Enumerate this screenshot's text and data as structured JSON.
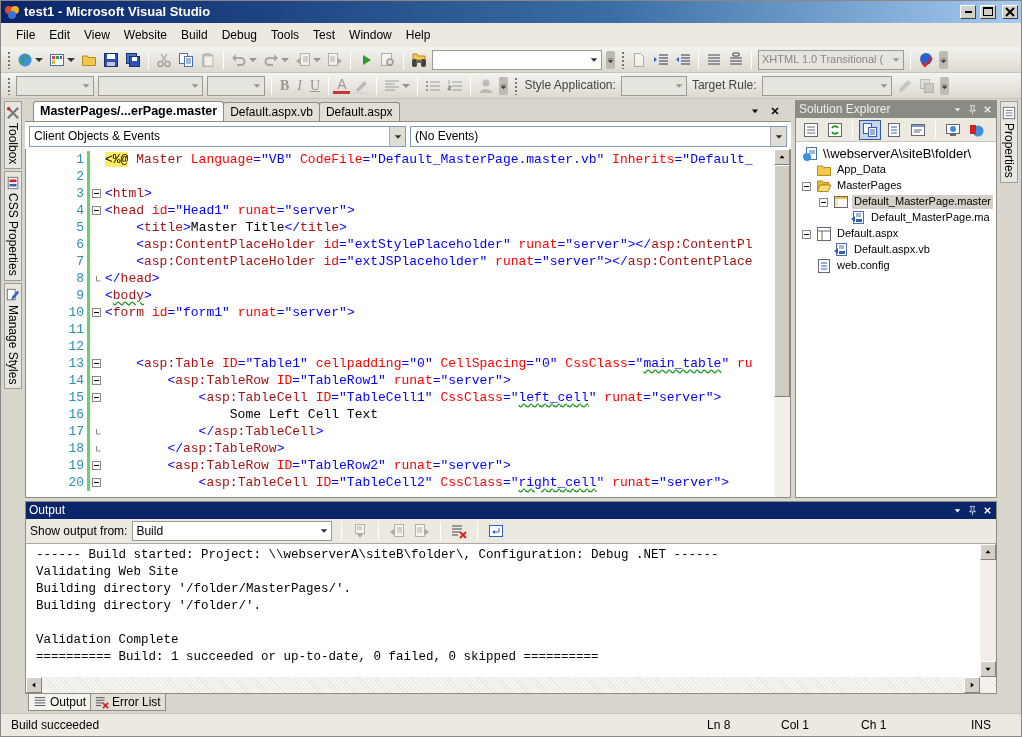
{
  "window": {
    "title": "test1 - Microsoft Visual Studio"
  },
  "menu": [
    "File",
    "Edit",
    "View",
    "Website",
    "Build",
    "Debug",
    "Tools",
    "Test",
    "Window",
    "Help"
  ],
  "toolbars": [
    {
      "items": [
        {
          "kind": "grip"
        },
        {
          "kind": "icon",
          "disabled": false,
          "dropdown": true
        },
        {
          "kind": "icon",
          "disabled": false,
          "dropdown": true
        },
        {
          "kind": "icon",
          "disabled": false
        },
        {
          "kind": "icon",
          "disabled": false
        },
        {
          "kind": "icon",
          "disabled": false
        },
        {
          "kind": "sep"
        },
        {
          "kind": "icon",
          "disabled": true
        },
        {
          "kind": "icon",
          "disabled": false
        },
        {
          "kind": "icon",
          "disabled": true
        },
        {
          "kind": "sep"
        },
        {
          "kind": "icon",
          "disabled": true,
          "dropdown": true
        },
        {
          "kind": "icon",
          "disabled": true,
          "dropdown": true
        },
        {
          "kind": "icon",
          "disabled": true,
          "dropdown": true
        },
        {
          "kind": "icon",
          "disabled": true
        },
        {
          "kind": "sep"
        },
        {
          "kind": "icon",
          "disabled": false
        },
        {
          "kind": "icon",
          "disabled": true
        },
        {
          "kind": "sep"
        },
        {
          "kind": "icon",
          "disabled": false
        },
        {
          "kind": "combo",
          "disabled": false
        },
        {
          "kind": "overflow"
        },
        {
          "kind": "grip"
        },
        {
          "kind": "icon",
          "disabled": true
        },
        {
          "kind": "icon",
          "disabled": false
        },
        {
          "kind": "icon",
          "disabled": false
        },
        {
          "kind": "sep"
        },
        {
          "kind": "icon",
          "disabled": false
        },
        {
          "kind": "icon",
          "disabled": false
        },
        {
          "kind": "sep"
        },
        {
          "kind": "combo",
          "disabled": true,
          "value": "XHTML 1.0 Transitional ("
        },
        {
          "kind": "sep"
        },
        {
          "kind": "icon",
          "disabled": false
        },
        {
          "kind": "overflow"
        }
      ]
    },
    {
      "items": [
        {
          "kind": "grip"
        },
        {
          "kind": "combo",
          "disabled": true
        },
        {
          "kind": "combo",
          "disabled": true
        },
        {
          "kind": "combo",
          "disabled": true
        },
        {
          "kind": "sep"
        },
        {
          "kind": "glyph",
          "text": "B",
          "disabled": true
        },
        {
          "kind": "glyph",
          "text": "I",
          "disabled": true
        },
        {
          "kind": "glyph",
          "text": "U",
          "disabled": true
        },
        {
          "kind": "sep"
        },
        {
          "kind": "glyph",
          "text": "A",
          "disabled": true
        },
        {
          "kind": "icon",
          "disabled": true
        },
        {
          "kind": "sep"
        },
        {
          "kind": "icon",
          "disabled": true,
          "dropdown": true
        },
        {
          "kind": "sep"
        },
        {
          "kind": "icon",
          "disabled": true
        },
        {
          "kind": "icon",
          "disabled": true
        },
        {
          "kind": "sep"
        },
        {
          "kind": "icon",
          "disabled": true
        },
        {
          "kind": "overflow"
        },
        {
          "kind": "grip"
        },
        {
          "kind": "label",
          "text": "Style Application:"
        },
        {
          "kind": "combo",
          "disabled": true
        },
        {
          "kind": "label",
          "text": "Target Rule:"
        },
        {
          "kind": "combo",
          "disabled": true
        },
        {
          "kind": "icon",
          "disabled": true
        },
        {
          "kind": "icon",
          "disabled": true
        },
        {
          "kind": "overflow"
        }
      ]
    }
  ],
  "left_tabs": [
    "Toolbox",
    "CSS Properties",
    "Manage Styles"
  ],
  "right_tabs": [
    "Properties"
  ],
  "editor": {
    "tabs": [
      {
        "label": "MasterPages/...erPage.master",
        "selected": true
      },
      {
        "label": "Default.aspx.vb",
        "selected": false
      },
      {
        "label": "Default.aspx",
        "selected": false
      }
    ],
    "object_combo": "Client Objects & Events",
    "event_combo": "(No Events)",
    "lines": [
      {
        "number": "1",
        "tokens": [
          {
            "kind": "dir",
            "text": "<%@"
          },
          {
            "kind": "tag",
            "text": " Master"
          },
          {
            "kind": "attr",
            "text": " Language"
          },
          {
            "kind": "val",
            "text": "=\"VB\""
          },
          {
            "kind": "attr",
            "text": " CodeFile"
          },
          {
            "kind": "val",
            "text": "=\"Default_MasterPage.master.vb\""
          },
          {
            "kind": "attr",
            "text": " Inherits"
          },
          {
            "kind": "val",
            "text": "=\"Default_"
          }
        ]
      },
      {
        "number": "2"
      },
      {
        "number": "3",
        "collapsible": true,
        "tokens": [
          {
            "kind": "delim",
            "text": "<"
          },
          {
            "kind": "tag",
            "text": "html"
          },
          {
            "kind": "delim",
            "text": ">"
          }
        ]
      },
      {
        "number": "4",
        "collapsible": true,
        "tokens": [
          {
            "kind": "delim",
            "text": "<"
          },
          {
            "kind": "tag",
            "text": "head"
          },
          {
            "kind": "attr",
            "text": " id"
          },
          {
            "kind": "val",
            "text": "=\"Head1\""
          },
          {
            "kind": "attr",
            "text": " runat"
          },
          {
            "kind": "val",
            "text": "=\"server\""
          },
          {
            "kind": "delim",
            "text": ">"
          }
        ]
      },
      {
        "number": "5",
        "tokens": [
          {
            "kind": "delim",
            "text": "    <"
          },
          {
            "kind": "tag",
            "text": "title"
          },
          {
            "kind": "delim",
            "text": ">"
          },
          {
            "kind": "text",
            "text": "Master Title"
          },
          {
            "kind": "delim",
            "text": "</"
          },
          {
            "kind": "tag",
            "text": "title"
          },
          {
            "kind": "delim",
            "text": ">"
          }
        ]
      },
      {
        "number": "6",
        "tokens": [
          {
            "kind": "delim",
            "text": "    <"
          },
          {
            "kind": "tag",
            "text": "asp:ContentPlaceHolder"
          },
          {
            "kind": "attr",
            "text": " id"
          },
          {
            "kind": "val",
            "text": "=\"extStylePlaceholder\""
          },
          {
            "kind": "attr",
            "text": " runat"
          },
          {
            "kind": "val",
            "text": "=\"server\""
          },
          {
            "kind": "delim",
            "text": "></"
          },
          {
            "kind": "tag",
            "text": "asp:ContentPl"
          }
        ]
      },
      {
        "number": "7",
        "tokens": [
          {
            "kind": "delim",
            "text": "    <"
          },
          {
            "kind": "tag",
            "text": "asp:ContentPlaceHolder"
          },
          {
            "kind": "attr",
            "text": " id"
          },
          {
            "kind": "val",
            "text": "=\"extJSPlaceholder\""
          },
          {
            "kind": "attr",
            "text": " runat"
          },
          {
            "kind": "val",
            "text": "=\"server\""
          },
          {
            "kind": "delim",
            "text": "></"
          },
          {
            "kind": "tag",
            "text": "asp:ContentPlace"
          }
        ]
      },
      {
        "number": "8",
        "block_end": true,
        "tokens": [
          {
            "kind": "delim",
            "text": "</"
          },
          {
            "kind": "tag",
            "text": "head"
          },
          {
            "kind": "delim",
            "text": ">"
          }
        ]
      },
      {
        "number": "9",
        "tokens": [
          {
            "kind": "delim",
            "text": "<"
          },
          {
            "kind": "tag",
            "text": "body",
            "squiggle": true
          },
          {
            "kind": "delim",
            "text": ">"
          }
        ]
      },
      {
        "number": "10",
        "collapsible": true,
        "tokens": [
          {
            "kind": "delim",
            "text": "<"
          },
          {
            "kind": "tag",
            "text": "form"
          },
          {
            "kind": "attr",
            "text": " id"
          },
          {
            "kind": "val",
            "text": "=\"form1\""
          },
          {
            "kind": "attr",
            "text": " runat"
          },
          {
            "kind": "val",
            "text": "=\"server\""
          },
          {
            "kind": "delim",
            "text": ">"
          }
        ]
      },
      {
        "number": "11"
      },
      {
        "number": "12"
      },
      {
        "number": "13",
        "collapsible": true,
        "tokens": [
          {
            "kind": "delim",
            "text": "    <"
          },
          {
            "kind": "tag",
            "text": "asp:Table"
          },
          {
            "kind": "attr",
            "text": " ID"
          },
          {
            "kind": "val",
            "text": "=\"Table1\""
          },
          {
            "kind": "attr",
            "text": " cellpadding"
          },
          {
            "kind": "val",
            "text": "=\"0\""
          },
          {
            "kind": "attr",
            "text": " CellSpacing"
          },
          {
            "kind": "val",
            "text": "=\"0\""
          },
          {
            "kind": "attr",
            "text": " CssClass"
          },
          {
            "kind": "val",
            "text": "=\""
          },
          {
            "kind": "val",
            "text": "main_table",
            "squiggle": true
          },
          {
            "kind": "val",
            "text": "\""
          },
          {
            "kind": "attr",
            "text": " ru"
          }
        ]
      },
      {
        "number": "14",
        "collapsible": true,
        "tokens": [
          {
            "kind": "delim",
            "text": "        <"
          },
          {
            "kind": "tag",
            "text": "asp:TableRow"
          },
          {
            "kind": "attr",
            "text": " ID"
          },
          {
            "kind": "val",
            "text": "=\"TableRow1\""
          },
          {
            "kind": "attr",
            "text": " runat"
          },
          {
            "kind": "val",
            "text": "=\"server\""
          },
          {
            "kind": "delim",
            "text": ">"
          }
        ]
      },
      {
        "number": "15",
        "collapsible": true,
        "tokens": [
          {
            "kind": "delim",
            "text": "            <"
          },
          {
            "kind": "tag",
            "text": "asp:TableCell"
          },
          {
            "kind": "attr",
            "text": " ID"
          },
          {
            "kind": "val",
            "text": "=\"TableCell1\""
          },
          {
            "kind": "attr",
            "text": " CssClass"
          },
          {
            "kind": "val",
            "text": "=\""
          },
          {
            "kind": "val",
            "text": "left_cell",
            "squiggle": true
          },
          {
            "kind": "val",
            "text": "\""
          },
          {
            "kind": "attr",
            "text": " runat"
          },
          {
            "kind": "val",
            "text": "=\"server\""
          },
          {
            "kind": "delim",
            "text": ">"
          }
        ]
      },
      {
        "number": "16",
        "tokens": [
          {
            "kind": "text",
            "text": "                Some Left Cell Text"
          }
        ]
      },
      {
        "number": "17",
        "block_end": true,
        "tokens": [
          {
            "kind": "delim",
            "text": "            </"
          },
          {
            "kind": "tag",
            "text": "asp:TableCell"
          },
          {
            "kind": "delim",
            "text": ">"
          }
        ]
      },
      {
        "number": "18",
        "block_end": true,
        "tokens": [
          {
            "kind": "delim",
            "text": "        </"
          },
          {
            "kind": "tag",
            "text": "asp:TableRow"
          },
          {
            "kind": "delim",
            "text": ">"
          }
        ]
      },
      {
        "number": "19",
        "collapsible": true,
        "tokens": [
          {
            "kind": "delim",
            "text": "        <"
          },
          {
            "kind": "tag",
            "text": "asp:TableRow"
          },
          {
            "kind": "attr",
            "text": " ID"
          },
          {
            "kind": "val",
            "text": "=\"TableRow2\""
          },
          {
            "kind": "attr",
            "text": " runat"
          },
          {
            "kind": "val",
            "text": "=\"server\""
          },
          {
            "kind": "delim",
            "text": ">"
          }
        ]
      },
      {
        "number": "20",
        "collapsible": true,
        "tokens": [
          {
            "kind": "delim",
            "text": "            <"
          },
          {
            "kind": "tag",
            "text": "asp:TableCell"
          },
          {
            "kind": "attr",
            "text": " ID"
          },
          {
            "kind": "val",
            "text": "=\"TableCell2\""
          },
          {
            "kind": "attr",
            "text": " CssClass"
          },
          {
            "kind": "val",
            "text": "=\""
          },
          {
            "kind": "val",
            "text": "right_cell",
            "squiggle": true
          },
          {
            "kind": "val",
            "text": "\""
          },
          {
            "kind": "attr",
            "text": " runat"
          },
          {
            "kind": "val",
            "text": "=\"server\""
          },
          {
            "kind": "delim",
            "text": ">"
          }
        ]
      }
    ]
  },
  "solution_explorer": {
    "title": "Solution Explorer",
    "tools": [
      {
        "pressed": false
      },
      {
        "pressed": false
      },
      {
        "pressed": true
      },
      {
        "pressed": false
      },
      {
        "pressed": false
      },
      {
        "pressed": false
      },
      {
        "pressed": false
      }
    ],
    "tree": {
      "label": "\\\\webserverA\\siteB\\folder\\",
      "kind": "project",
      "selected": false,
      "children": [
        {
          "label": "App_Data",
          "kind": "folder",
          "selected": false
        },
        {
          "label": "MasterPages",
          "kind": "folder-open",
          "selected": false,
          "expanded": true,
          "children": [
            {
              "label": "Default_MasterPage.master",
              "kind": "master",
              "selected": true,
              "expanded": true,
              "children": [
                {
                  "label": "Default_MasterPage.ma",
                  "kind": "code",
                  "selected": false
                }
              ]
            }
          ]
        },
        {
          "label": "Default.aspx",
          "kind": "page",
          "selected": false,
          "expanded": true,
          "children": [
            {
              "label": "Default.aspx.vb",
              "kind": "code",
              "selected": false
            }
          ]
        },
        {
          "label": "web.config",
          "kind": "config",
          "selected": false
        }
      ]
    }
  },
  "output": {
    "title": "Output",
    "show_from_label": "Show output from:",
    "source": "Build",
    "tools": [
      {
        "disabled": true
      },
      {
        "disabled": true
      },
      {
        "disabled": true
      },
      {
        "disabled": false
      },
      {
        "disabled": false
      }
    ],
    "blocks": [
      [
        "------ Build started: Project: \\\\webserverA\\siteB\\folder\\, Configuration: Debug .NET ------",
        "Validating Web Site",
        "Building directory '/folder/MasterPages/'.",
        "Building directory '/folder/'."
      ],
      [
        "Validation Complete",
        "========== Build: 1 succeeded or up-to-date, 0 failed, 0 skipped =========="
      ]
    ],
    "tabs": [
      {
        "label": "Output",
        "selected": true
      },
      {
        "label": "Error List",
        "selected": false
      }
    ]
  },
  "status_bar": {
    "message": "Build succeeded",
    "fields": [
      "Ln 8",
      "Col 1",
      "Ch 1",
      "INS"
    ]
  }
}
